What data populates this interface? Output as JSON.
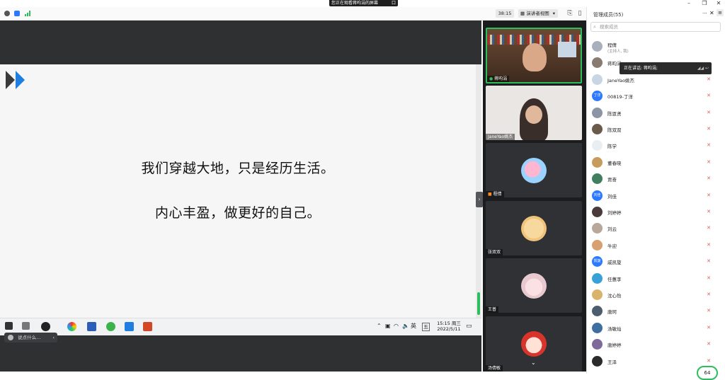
{
  "banner": {
    "text": "您正在观看蒋昀涓的屏幕",
    "suffix": "口"
  },
  "toolbar": {
    "timer": "38:15",
    "view_mode": "演讲者视图",
    "view_arrow": "▾"
  },
  "slide": {
    "line1": "我们穿越大地，只是经历生活。",
    "line2": "内心丰盈，做更好的自己。"
  },
  "taskbar": {
    "time": "15:15 周三",
    "date": "2022/5/11",
    "lang": "英",
    "ime": "五"
  },
  "chat": {
    "placeholder": "说点什么...",
    "arrow": "‹"
  },
  "videos": [
    {
      "name": "蒋昀涓"
    },
    {
      "name": "JaneYao姚杰"
    },
    {
      "name": "程倩"
    },
    {
      "name": "张双双"
    },
    {
      "name": "王普"
    },
    {
      "name": "汤倩敏"
    }
  ],
  "panel": {
    "title": "管理成员(55)",
    "search_placeholder": "搜索成员",
    "talking_tip": "正在讲话: 蒋昀涓;",
    "members": [
      {
        "name": "程倩",
        "sub": "(主持人, 我)",
        "av": "#a9b0bd",
        "av_text": ""
      },
      {
        "name": "蒋昀涓",
        "sub": "",
        "av": "#8a7b70",
        "av_text": ""
      },
      {
        "name": "JaneYao姚杰",
        "sub": "",
        "av": "#c8d6e3",
        "av_text": ""
      },
      {
        "name": "00819-丁洋",
        "sub": "",
        "av": "#2a79ff",
        "av_text": "丁洋"
      },
      {
        "name": "陈恩贤",
        "sub": "",
        "av": "#8b95a4",
        "av_text": ""
      },
      {
        "name": "陈双双",
        "sub": "",
        "av": "#6a5a4a",
        "av_text": ""
      },
      {
        "name": "陈学",
        "sub": "",
        "av": "#e9eef3",
        "av_text": ""
      },
      {
        "name": "董春晓",
        "sub": "",
        "av": "#c79a5e",
        "av_text": ""
      },
      {
        "name": "贾奋",
        "sub": "",
        "av": "#3f7f5f",
        "av_text": ""
      },
      {
        "name": "刘佳",
        "sub": "",
        "av": "#2a79ff",
        "av_text": "刘佳"
      },
      {
        "name": "刘婷婷",
        "sub": "",
        "av": "#4a3a3a",
        "av_text": ""
      },
      {
        "name": "刘云",
        "sub": "",
        "av": "#b9a79a",
        "av_text": ""
      },
      {
        "name": "牛迎",
        "sub": "",
        "av": "#d8a070",
        "av_text": ""
      },
      {
        "name": "戚凯旋",
        "sub": "",
        "av": "#2a79ff",
        "av_text": "凯旋"
      },
      {
        "name": "任蕙李",
        "sub": "",
        "av": "#3aa0d8",
        "av_text": ""
      },
      {
        "name": "沈心怡",
        "sub": "",
        "av": "#d9b36b",
        "av_text": ""
      },
      {
        "name": "唐珂",
        "sub": "",
        "av": "#4c5d6e",
        "av_text": ""
      },
      {
        "name": "汤敏灿",
        "sub": "",
        "av": "#3f6fa0",
        "av_text": ""
      },
      {
        "name": "唐婷婷",
        "sub": "",
        "av": "#7d6a9a",
        "av_text": ""
      },
      {
        "name": "王泽",
        "sub": "",
        "av": "#2b2b2b",
        "av_text": ""
      }
    ],
    "muted_label": "✕",
    "count_badge": "64"
  },
  "colors": {
    "accent": "#2dbd5d",
    "chevron": "#1f7fe0",
    "chevron_dark": "#3a3a3a"
  }
}
